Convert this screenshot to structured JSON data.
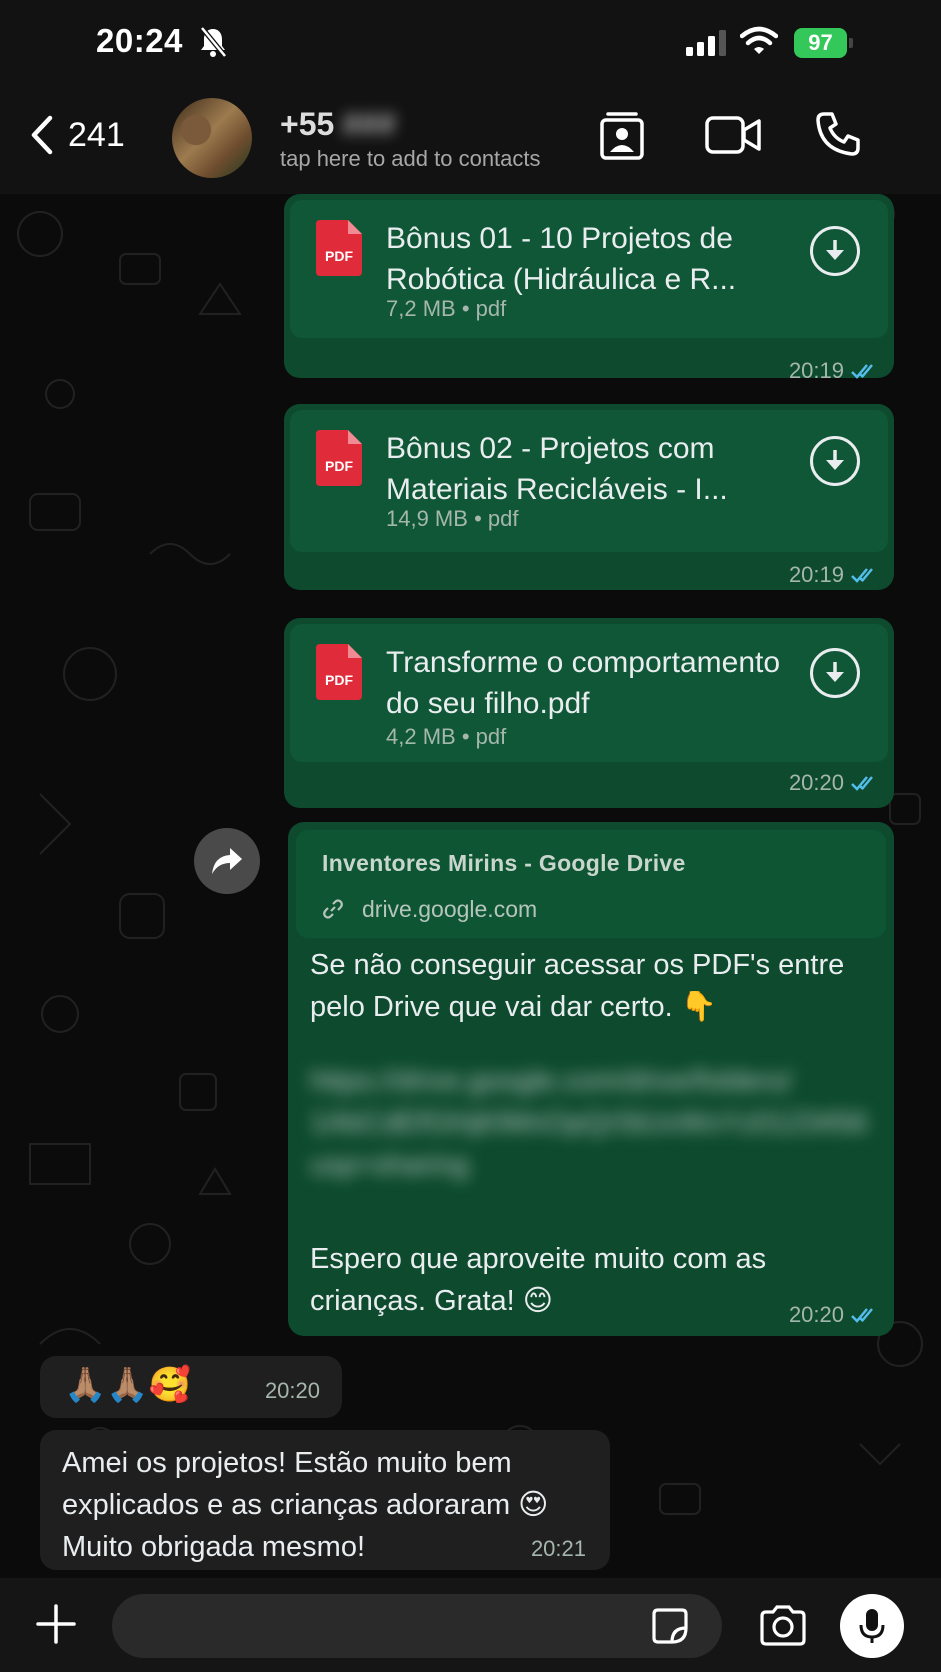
{
  "status_bar": {
    "time": "20:24",
    "battery": "97",
    "icons": [
      "bell-slash-icon",
      "signal-icon",
      "wifi-icon",
      "battery-icon"
    ]
  },
  "header": {
    "back_count": "241",
    "contact_prefix": "+55",
    "contact_number_redacted": "###",
    "contact_subtitle": "tap here to add to contacts",
    "icons": [
      "contact-card-icon",
      "video-call-icon",
      "voice-call-icon"
    ]
  },
  "messages": [
    {
      "type": "document",
      "direction": "outgoing",
      "title_line1": "Bônus 01 - 10 Projetos de",
      "title_line2": "Robótica (Hidráulica e R...",
      "size": "7,2 MB",
      "ext": "pdf",
      "time": "20:19"
    },
    {
      "type": "document",
      "direction": "outgoing",
      "title_line1": "Bônus 02 - Projetos com",
      "title_line2": "Materiais Recicláveis - I...",
      "size": "14,9 MB",
      "ext": "pdf",
      "time": "20:19"
    },
    {
      "type": "document",
      "direction": "outgoing",
      "title_line1": "Transforme o comportamento",
      "title_line2": "do seu filho.pdf",
      "size": "4,2 MB",
      "ext": "pdf",
      "time": "20:20"
    },
    {
      "type": "link",
      "direction": "outgoing",
      "link_title": "Inventores Mirins - Google Drive",
      "link_url": "drive.google.com",
      "text_line1": "Se não conseguir acessar os PDF's entre",
      "text_line2": "pelo Drive que vai dar certo. 👇",
      "blurred_line1": "https://drive.google.com/drive/folders/",
      "blurred_line2": "1AbCdEfGhIjKlMnOpQrStUvWxYz0123456",
      "blurred_line3": "usp=sharing",
      "text_line3": "Espero que aproveite muito com as",
      "text_line4": "crianças. Grata! 😊",
      "time": "20:20"
    },
    {
      "type": "text",
      "direction": "incoming",
      "text": "🙏🏽🙏🏽🥰",
      "time": "20:20"
    },
    {
      "type": "text",
      "direction": "incoming",
      "text_line1": "Amei os projetos! Estão muito bem",
      "text_line2": "explicados e as crianças adoraram 😍",
      "text_line3": "Muito obrigada mesmo!",
      "time": "20:21"
    }
  ],
  "pdf_badge": "PDF",
  "meta_separator": "•",
  "colors": {
    "outgoing_bubble": "#0d4a2e",
    "incoming_bubble": "#1f1f1f",
    "read_ticks": "#53bdeb",
    "battery": "#34c759"
  }
}
